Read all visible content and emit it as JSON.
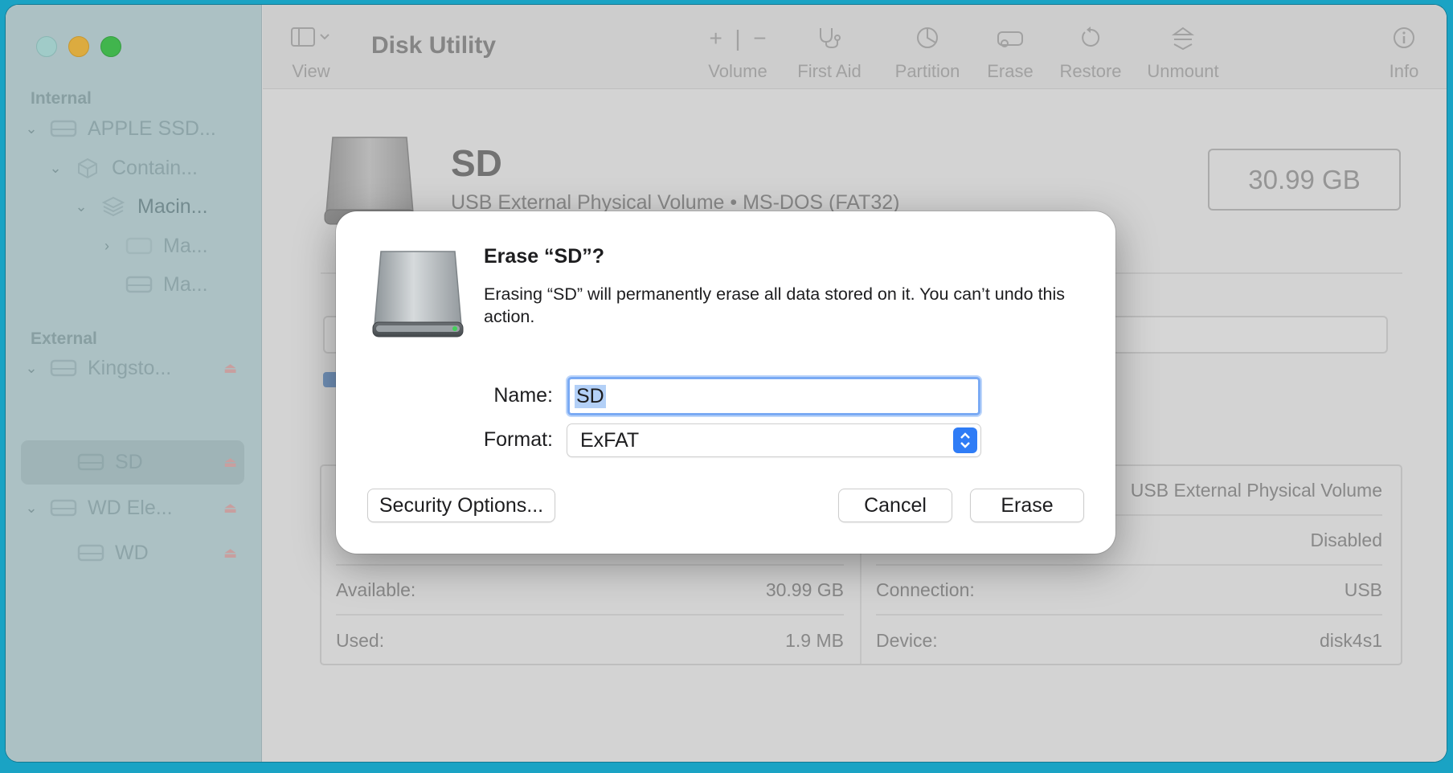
{
  "window": {
    "app_title": "Disk Utility"
  },
  "sidebar": {
    "internal_title": "Internal",
    "external_title": "External",
    "items": [
      {
        "label": "APPLE SSD..."
      },
      {
        "label": "Contain..."
      },
      {
        "label": "Macin..."
      },
      {
        "label": "Ma..."
      },
      {
        "label": "Ma..."
      },
      {
        "label": "Kingsto..."
      },
      {
        "label": "SD"
      },
      {
        "label": "WD Ele..."
      },
      {
        "label": "WD"
      }
    ]
  },
  "toolbar": {
    "view_label": "View",
    "volume_label": "Volume",
    "first_aid_label": "First Aid",
    "partition_label": "Partition",
    "erase_label": "Erase",
    "restore_label": "Restore",
    "unmount_label": "Unmount",
    "info_label": "Info"
  },
  "volume": {
    "name": "SD",
    "subtitle": "USB External Physical Volume • MS-DOS (FAT32)",
    "size": "30.99 GB"
  },
  "info": {
    "type_value": "USB External Physical Volume",
    "owners_value": "Disabled",
    "available_label": "Available:",
    "available_value": "30.99 GB",
    "connection_label": "Connection:",
    "connection_value": "USB",
    "used_label": "Used:",
    "used_value": "1.9 MB",
    "device_label": "Device:",
    "device_value": "disk4s1"
  },
  "dialog": {
    "title": "Erase “SD”?",
    "message": "Erasing “SD” will permanently erase all data stored on it. You can’t undo this action.",
    "name_label": "Name:",
    "name_value": "SD",
    "format_label": "Format:",
    "format_value": "ExFAT",
    "security_button": "Security Options...",
    "cancel_button": "Cancel",
    "erase_button": "Erase"
  },
  "colors": {
    "desktop": "#1aa3c4",
    "sidebar": "#b8d2d6",
    "accent": "#2f7cf6",
    "focus_ring": "#7aaaf4"
  }
}
